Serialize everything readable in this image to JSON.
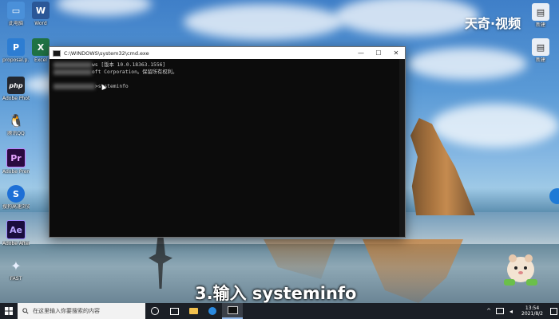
{
  "desktop": {
    "icons": [
      {
        "label": "此电脑",
        "glyph": "▭",
        "color": "#4a90d9"
      },
      {
        "label": "Word",
        "glyph": "W",
        "color": "#2b5797"
      },
      {
        "label": "proposal.p...",
        "glyph": "P",
        "color": "#2d7dd2"
      },
      {
        "label": "Excel",
        "glyph": "X",
        "color": "#1f7244"
      },
      {
        "label": "Adobe Photoshop...",
        "glyph": "php",
        "color": "#23272e"
      },
      {
        "label": "腾讯QQ",
        "glyph": "🐧",
        "color": "transparent"
      },
      {
        "label": "Adobe Premiere...",
        "glyph": "Pr",
        "color": "#2a0a3f"
      },
      {
        "label": "搜狗高速浏览器",
        "glyph": "S",
        "color": "#1d6fd6"
      },
      {
        "label": "Adobe After Effects 2020",
        "glyph": "Ae",
        "color": "#1a0d3d"
      },
      {
        "label": "FAST",
        "glyph": "✦",
        "color": "transparent"
      }
    ],
    "right_icons": [
      {
        "label": "新建",
        "glyph": "▤",
        "color": "#e9eef5"
      },
      {
        "label": "新建",
        "glyph": "▤",
        "color": "#e9eef5"
      }
    ]
  },
  "cmd_window": {
    "title": "C:\\WINDOWS\\system32\\cmd.exe",
    "controls": {
      "minimize": "—",
      "maximize": "☐",
      "close": "✕"
    },
    "line1": "ws [版本 10.0.18363.1556]",
    "line2": "oft Corporation。保留所有权利。",
    "prompt_command": ">systeminfo"
  },
  "overlay": {
    "logo": "天奇·视频",
    "caption": "3.输入 systeminfo"
  },
  "taskbar": {
    "search_placeholder": "在这里输入你要搜索的内容",
    "time": "13:54",
    "date": "2021/8/2"
  }
}
